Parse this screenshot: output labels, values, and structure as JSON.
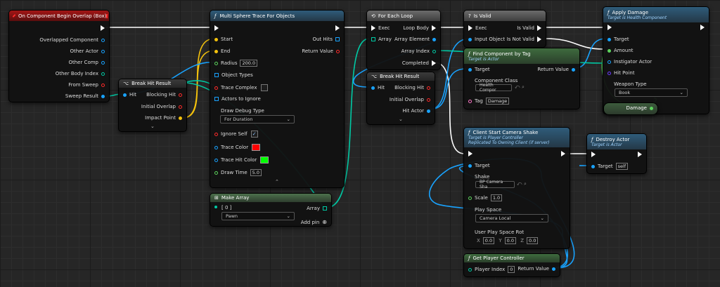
{
  "colors": {
    "exec": "#ffffff",
    "object": "#19a3ff",
    "bool": "#ff2a2a",
    "vector": "#f4c20d",
    "float": "#5cd35c",
    "struct": "#00c9a4",
    "class": "#6b3cff",
    "name": "#ff77c8"
  },
  "nodes": {
    "event": {
      "title": "On Component Begin Overlap (Box)",
      "pins": [
        "Overlapped Component",
        "Other Actor",
        "Other Comp",
        "Other Body Index",
        "From Sweep",
        "Sweep Result"
      ]
    },
    "break1": {
      "title": "Break Hit Result",
      "hit": "Hit",
      "blocking": "Blocking Hit",
      "initial": "Initial Overlap",
      "impact": "Impact Point"
    },
    "trace": {
      "title": "Multi Sphere Trace For Objects",
      "start": "Start",
      "end": "End",
      "radius": "Radius",
      "radius_val": "200.0",
      "object_types": "Object Types",
      "trace_complex": "Trace Complex",
      "actors_ignore": "Actors to Ignore",
      "draw_debug": "Draw Debug Type",
      "draw_debug_val": "For Duration",
      "ignore_self": "Ignore Self",
      "trace_color": "Trace Color",
      "trace_hit_color": "Trace Hit Color",
      "draw_time": "Draw Time",
      "draw_time_val": "5.0",
      "out_hits": "Out Hits",
      "return_value": "Return Value"
    },
    "makearray": {
      "title": "Make Array",
      "index0": "[ 0 ]",
      "pawn": "Pawn",
      "array": "Array",
      "add_pin": "Add pin"
    },
    "foreach": {
      "title": "For Each Loop",
      "exec": "Exec",
      "array": "Array",
      "loop_body": "Loop Body",
      "array_element": "Array Element",
      "array_index": "Array Index",
      "completed": "Completed"
    },
    "break2": {
      "title": "Break Hit Result",
      "hit": "Hit",
      "blocking": "Blocking Hit",
      "initial": "Initial Overlap",
      "hit_actor": "Hit Actor"
    },
    "isvalid": {
      "title": "Is Valid",
      "exec": "Exec",
      "input": "Input Object",
      "is_valid": "Is Valid",
      "is_not_valid": "Is Not Valid"
    },
    "findcomp": {
      "title": "Find Component by Tag",
      "subtitle": "Target is Actor",
      "target": "Target",
      "comp_class": "Component Class",
      "comp_class_val": "Health Compor",
      "tag": "Tag",
      "tag_val": "Damage",
      "return_value": "Return Value"
    },
    "applydamage": {
      "title": "Apply Damage",
      "subtitle": "Target is Health Component",
      "target": "Target",
      "amount": "Amount",
      "instigator": "Instigator Actor",
      "hit_point": "Hit Point",
      "weapon_type": "Weapon Type",
      "weapon_val": "Book",
      "damage": "Damage"
    },
    "camshake": {
      "title": "Client Start Camera Shake",
      "subtitle": "Target is Player Controller",
      "subtitle2": "Replicated To Owning Client (if server)",
      "target": "Target",
      "shake": "Shake",
      "shake_val": "BP Camera Sha",
      "scale": "Scale",
      "scale_val": "1.0",
      "play_space": "Play Space",
      "play_space_val": "Camera Local",
      "user_rot": "User Play Space Rot",
      "x": "X",
      "xv": "0.0",
      "y": "Y",
      "yv": "0.0",
      "z": "Z",
      "zv": "0.0"
    },
    "destroy": {
      "title": "Destroy Actor",
      "subtitle": "Target is Actor",
      "target": "Target",
      "target_val": "self"
    },
    "getpc": {
      "title": "Get Player Controller",
      "player_index": "Player Index",
      "player_index_val": "0",
      "return_value": "Return Value"
    }
  }
}
